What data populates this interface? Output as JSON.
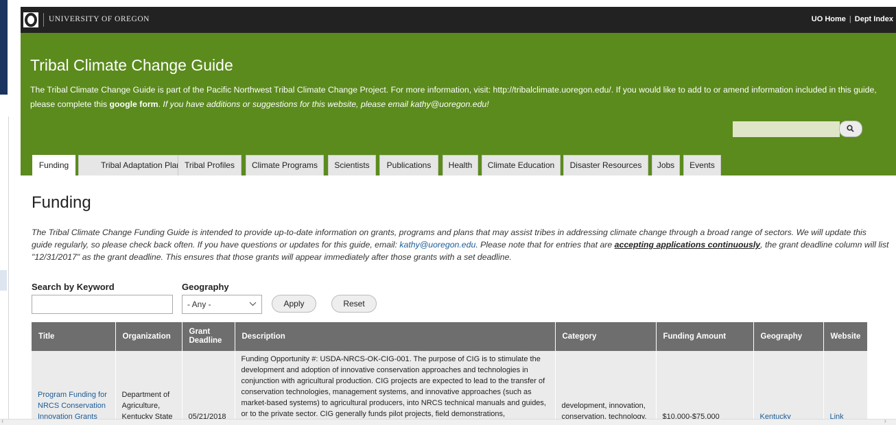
{
  "topbar": {
    "university": "UNIVERSITY OF OREGON",
    "links": [
      "UO Home",
      "Dept Index"
    ]
  },
  "header": {
    "title": "Tribal Climate Change Guide",
    "desc_1": "The Tribal Climate Change Guide is part of the Pacific Northwest Tribal Climate Change Project. For more information, visit: http://tribalclimate.uoregon.edu/. If you would like to add to or amend information included in this guide, please complete this ",
    "desc_link": "google form",
    "desc_2": ". ",
    "desc_italic": "If you have additions or suggestions for this website, please email kathy@uoregon.edu!"
  },
  "tabs": [
    "Funding",
    "Tribal Adaptation Plans",
    "Tribal Profiles",
    "Climate Programs",
    "Scientists",
    "Publications",
    "Health",
    "Climate Education",
    "Disaster Resources",
    "Jobs",
    "Events"
  ],
  "page": {
    "heading": "Funding",
    "intro_1": "The Tribal Climate Change Funding Guide is intended to provide up-to-date information on grants, programs and plans that may assist tribes in addressing climate change through a broad range of sectors. We will update this guide regularly, so please check back often. If you have questions or updates for this guide, email: ",
    "intro_email": "kathy@uoregon.edu",
    "intro_2": ". Please note that for entries that are ",
    "intro_bold": "accepting applications continuously",
    "intro_3": ", the grant deadline column will list \"12/31/2017\" as the grant deadline. This ensures that those grants will appear immediately after those grants with a set deadline."
  },
  "filters": {
    "keyword_label": "Search by Keyword",
    "keyword_value": "",
    "geography_label": "Geography",
    "geography_value": "- Any -",
    "apply": "Apply",
    "reset": "Reset"
  },
  "table": {
    "headers": [
      "Title",
      "Organization",
      "Grant Deadline",
      "Description",
      "Category",
      "Funding Amount",
      "Geography",
      "Website"
    ],
    "row": {
      "title": "Program Funding for NRCS Conservation Innovation Grants",
      "organization": "Department of Agriculture, Kentucky State",
      "deadline": "05/21/2018",
      "description": "Funding Opportunity #: USDA-NRCS-OK-CIG-001. The purpose of CIG is to stimulate the development and adoption of innovative conservation approaches and technologies in conjunction with agricultural production. CIG projects are expected to lead to the transfer of conservation technologies, management systems, and innovative approaches (such as market-based systems) to agricultural producers, into NRCS technical manuals and guides, or to the private sector. CIG generally funds pilot projects, field demonstrations,",
      "category": "development, innovation, conservation, technology, agriculture, grassland",
      "amount": "$10,000-$75,000",
      "geography": "Kentucky",
      "website": "Link"
    }
  },
  "colors": {
    "topbar": "#222222",
    "header_green": "#5b8a1d",
    "table_header": "#6e6e6e",
    "link": "#1a5c96"
  }
}
